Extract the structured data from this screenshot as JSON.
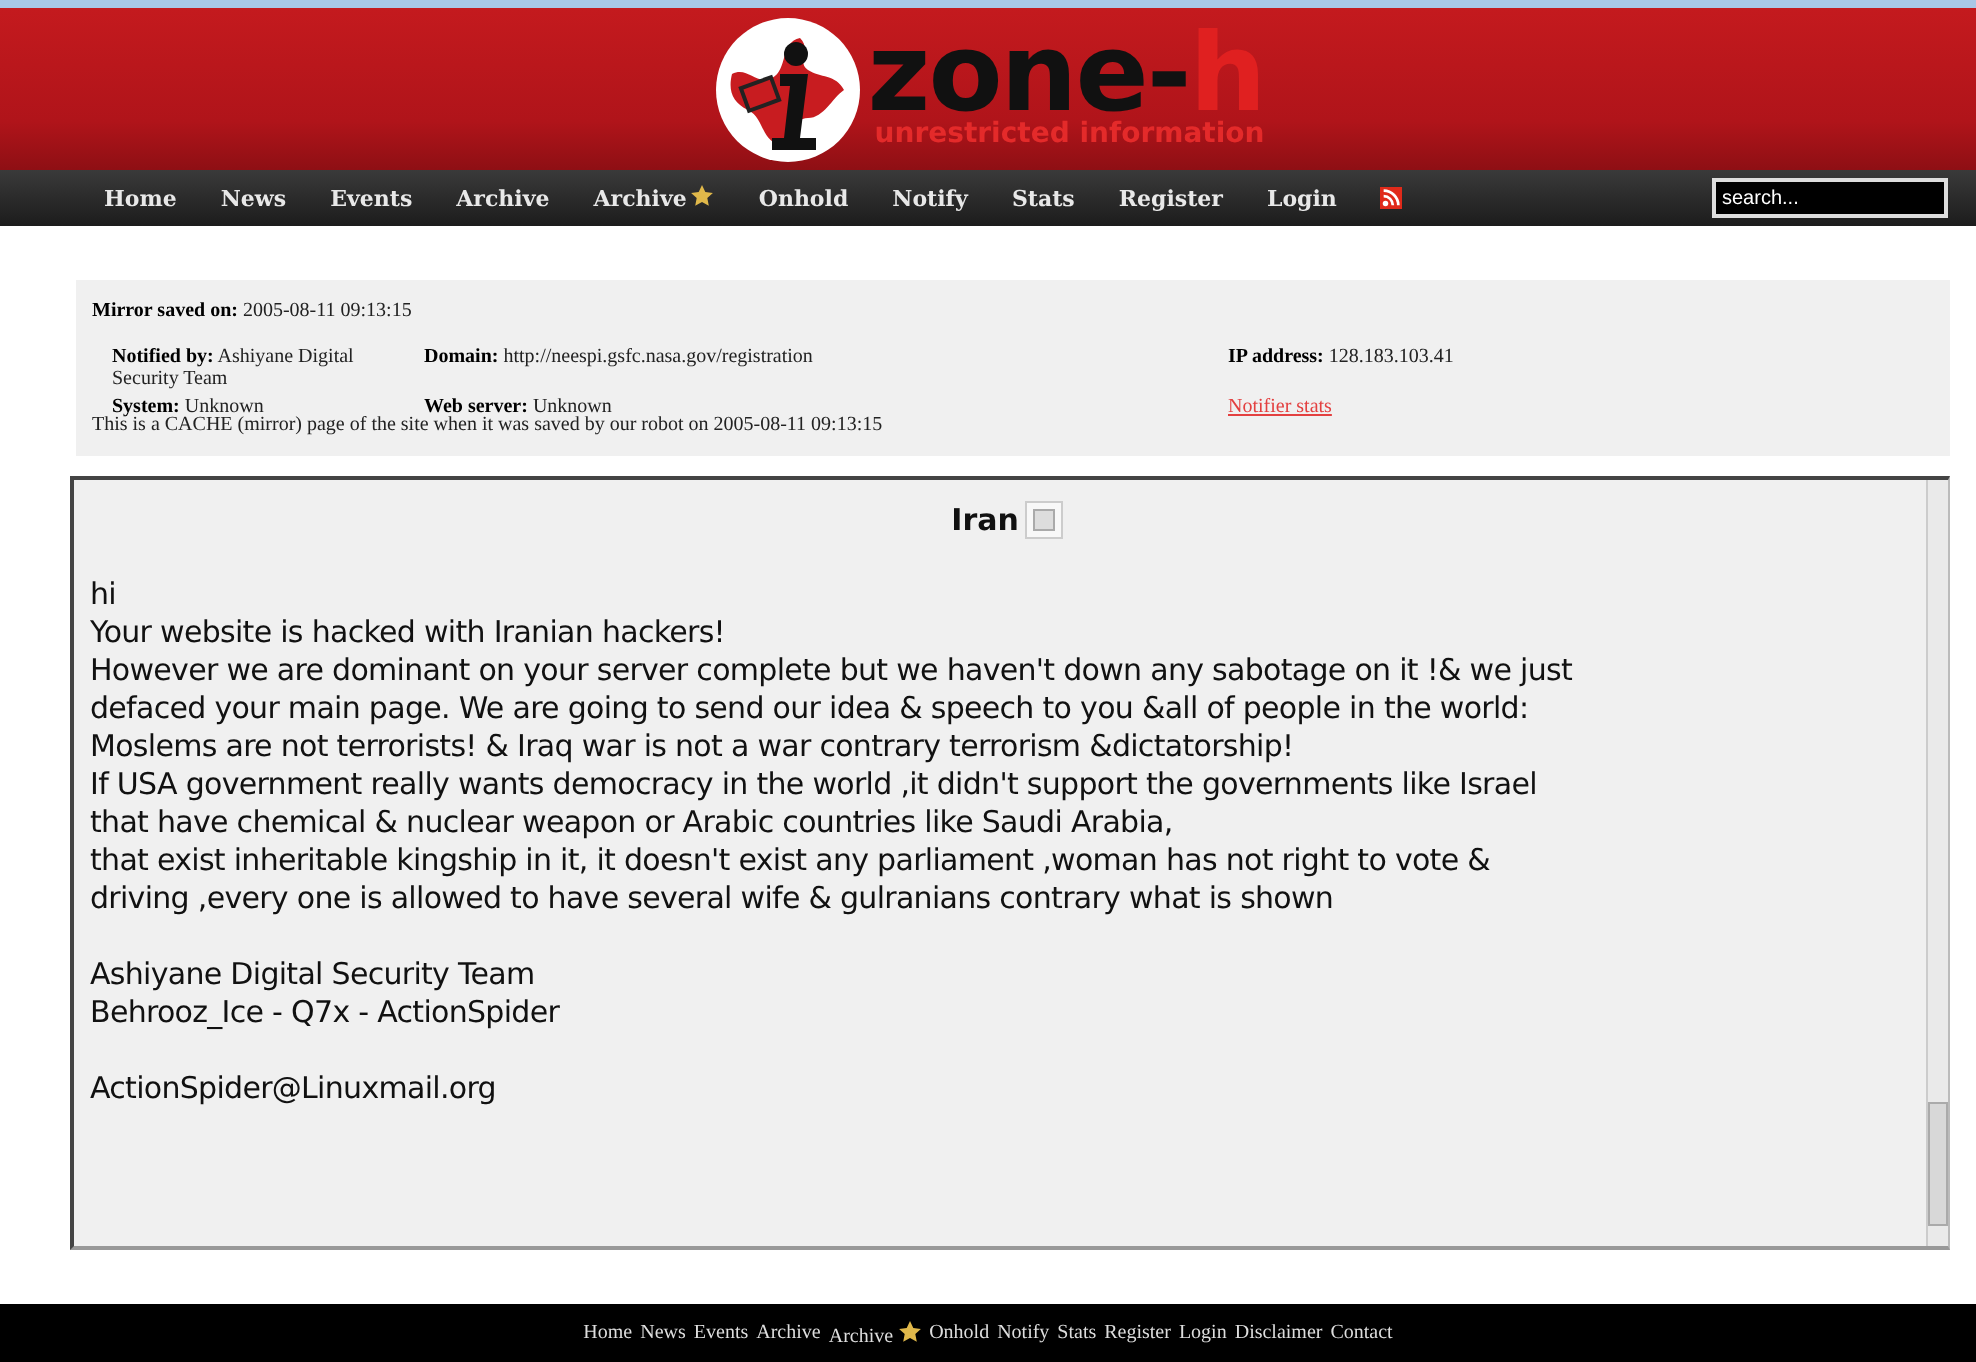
{
  "header": {
    "logo": {
      "name_main": "zone-",
      "name_accent": "h",
      "tagline": "unrestricted information"
    }
  },
  "nav": {
    "items": [
      {
        "label": "Home",
        "kind": "plain"
      },
      {
        "label": "News",
        "kind": "plain"
      },
      {
        "label": "Events",
        "kind": "plain"
      },
      {
        "label": "Archive",
        "kind": "plain"
      },
      {
        "label": "Archive",
        "kind": "star"
      },
      {
        "label": "Onhold",
        "kind": "plain"
      },
      {
        "label": "Notify",
        "kind": "plain"
      },
      {
        "label": "Stats",
        "kind": "plain"
      },
      {
        "label": "Register",
        "kind": "plain"
      },
      {
        "label": "Login",
        "kind": "plain"
      }
    ],
    "search": {
      "placeholder": "search..."
    }
  },
  "mirror_info": {
    "saved_label": "Mirror saved on:",
    "saved_value": "2005-08-11 09:13:15",
    "notified_label": "Notified by:",
    "notified_value": "Ashiyane Digital Security Team",
    "domain_label": "Domain:",
    "domain_value": "http://neespi.gsfc.nasa.gov/registration",
    "ip_label": "IP address:",
    "ip_value": "128.183.103.41",
    "system_label": "System:",
    "system_value": "Unknown",
    "server_label": "Web server:",
    "server_value": "Unknown",
    "stats_link": "Notifier stats",
    "note": "This is a CACHE (mirror) page of the site when it was saved by our robot on 2005-08-11 09:13:15"
  },
  "mirror_page": {
    "title": "Iran",
    "blocks": [
      [
        "hi",
        "Your website is hacked with Iranian hackers!",
        "However we are dominant on your server complete but we haven't down any sabotage on it !& we just",
        "defaced your main page. We are going to send our idea & speech to you &all of people in the world:",
        "Moslems are not terrorists! & Iraq war is not a war contrary terrorism &dictatorship!",
        "If USA government really wants democracy in the world ,it didn't support the governments like Israel",
        "that have chemical & nuclear weapon or Arabic countries like Saudi Arabia,",
        "that exist inheritable kingship in it, it doesn't exist any parliament ,woman has not right to vote &",
        "driving ,every one is allowed to have several wife & gulranians contrary what is shown"
      ],
      [
        "Ashiyane Digital Security Team",
        "Behrooz_Ice - Q7x - ActionSpider"
      ],
      [
        "ActionSpider@Linuxmail.org"
      ]
    ]
  },
  "footer": {
    "links": [
      {
        "label": "Home",
        "kind": "plain"
      },
      {
        "label": "News",
        "kind": "plain"
      },
      {
        "label": "Events",
        "kind": "plain"
      },
      {
        "label": "Archive",
        "kind": "plain"
      },
      {
        "label": "Archive",
        "kind": "star"
      },
      {
        "label": "Onhold",
        "kind": "plain"
      },
      {
        "label": "Notify",
        "kind": "plain"
      },
      {
        "label": "Stats",
        "kind": "plain"
      },
      {
        "label": "Register",
        "kind": "plain"
      },
      {
        "label": "Login",
        "kind": "plain"
      },
      {
        "label": "Disclaimer",
        "kind": "plain"
      },
      {
        "label": "Contact",
        "kind": "plain"
      }
    ]
  }
}
